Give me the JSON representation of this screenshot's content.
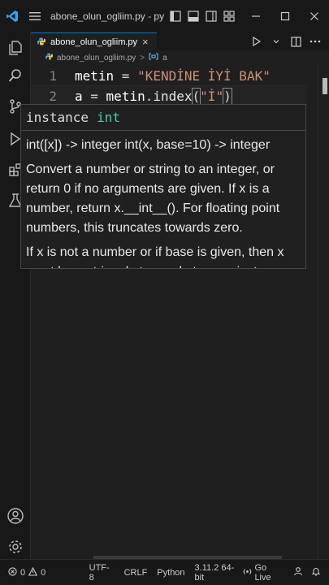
{
  "titlebar": {
    "title": "abone_olun_ogliim.py - pytho...",
    "icons": [
      "vscode-logo",
      "menu-icon",
      "layout-sidebar-left-icon",
      "layout-panel-icon",
      "layout-sidebar-right-icon",
      "customize-layout-icon",
      "minimize-icon",
      "maximize-icon",
      "close-icon"
    ]
  },
  "activity": [
    "explorer-icon",
    "search-icon",
    "source-control-icon",
    "run-debug-icon",
    "extensions-icon",
    "testing-icon",
    "accounts-icon",
    "settings-gear-icon"
  ],
  "tab": {
    "label": "abone_olun_ogliim.py",
    "close": "×"
  },
  "breadcrumb": {
    "file": "abone_olun_ogliim.py",
    "separator": ">",
    "symbol": "a"
  },
  "editor": {
    "lines": [
      {
        "number": "1",
        "var": "metin",
        "op": " = ",
        "str": "\"KENDİNE İYİ BAK\""
      },
      {
        "number": "2",
        "var": "a",
        "op": " = ",
        "obj": "metin",
        "dot": ".",
        "fn": "index",
        "open": "(",
        "arg": "\"İ\"",
        "close": ")"
      }
    ]
  },
  "hover": {
    "kind": "instance",
    "type": "int",
    "signature": "int([x]) -> integer int(x, base=10) -> integer",
    "para1": "Convert a number or string to an integer, or return 0 if no arguments are given. If x is a number, return x.__int__(). For floating point numbers, this truncates towards zero.",
    "para2": "If x is not a number or if base is given, then x must be a string, bytes, or bytearray instance"
  },
  "statusbar": {
    "errors": "0",
    "warnings": "0",
    "encoding": "UTF-8",
    "eol": "CRLF",
    "language": "Python",
    "interpreter": "3.11.2 64-bit",
    "golive": "Go Live"
  },
  "colors": {
    "accent": "#0078d4",
    "string": "#ce9178",
    "type": "#4ec9b0",
    "background": "#1f1f1f"
  }
}
